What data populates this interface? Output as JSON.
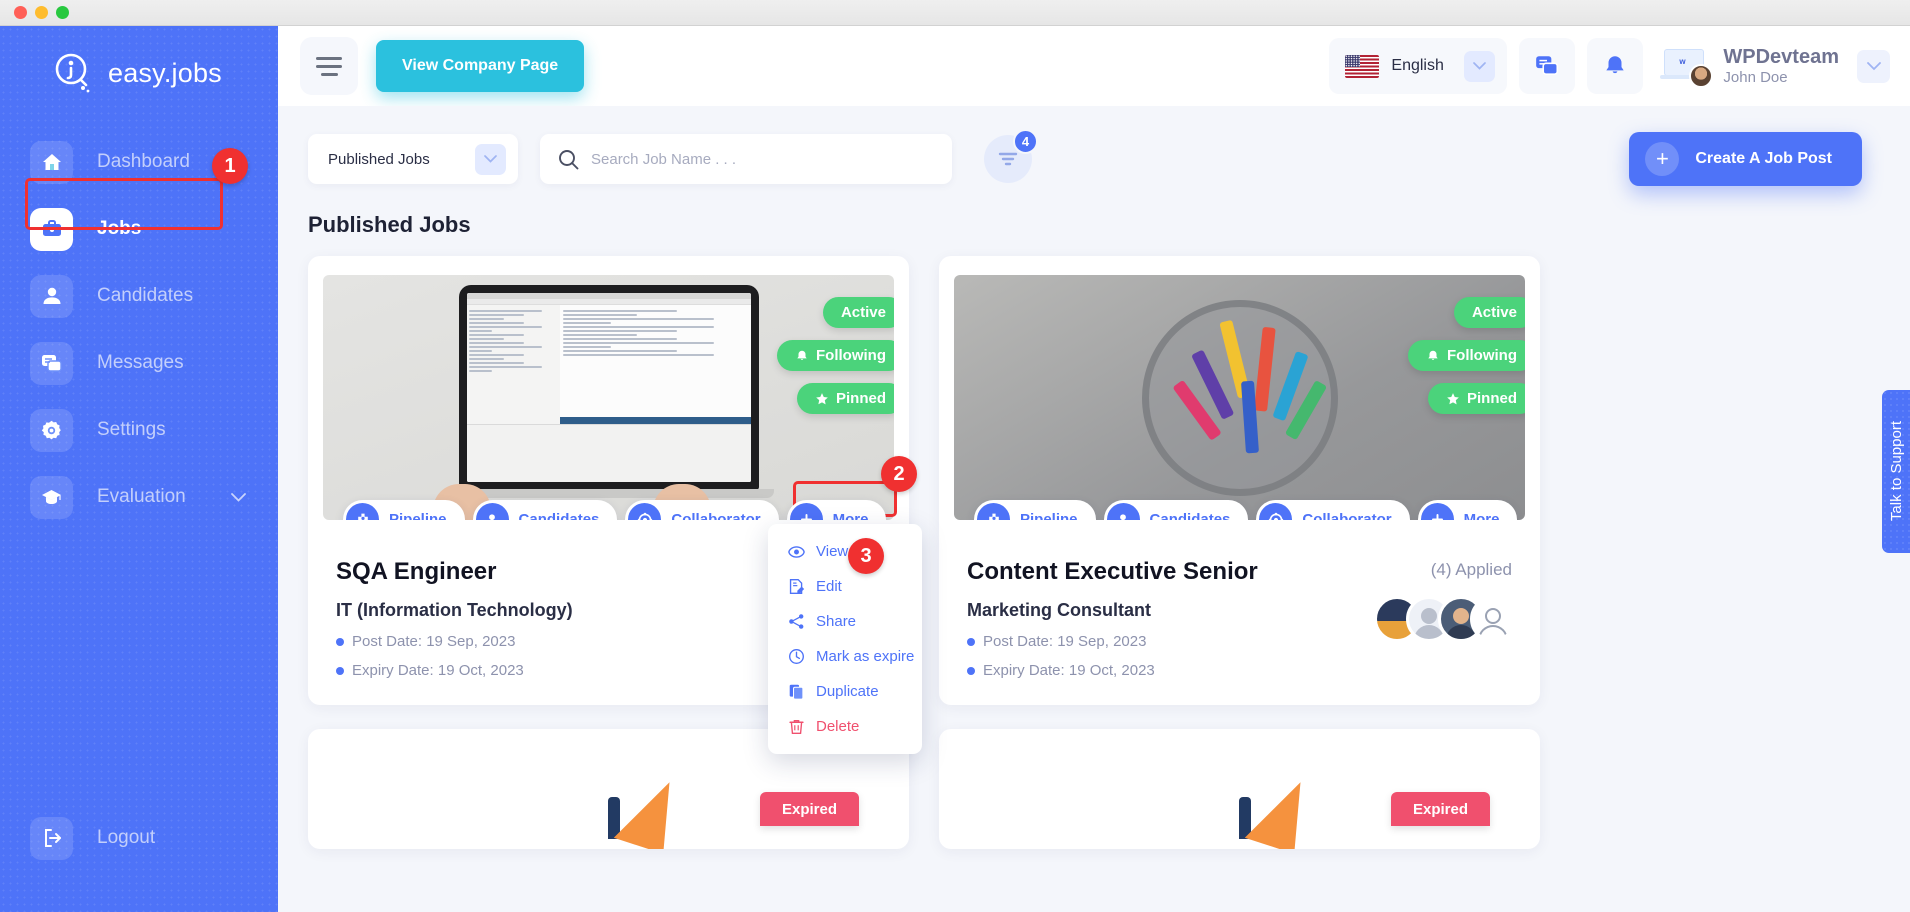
{
  "window": {
    "controls": [
      "close",
      "minimize",
      "maximize"
    ]
  },
  "sidebar": {
    "brand": "easy.jobs",
    "items": [
      {
        "label": "Dashboard",
        "icon": "home-icon",
        "active": false
      },
      {
        "label": "Jobs",
        "icon": "briefcase-icon",
        "active": true
      },
      {
        "label": "Candidates",
        "icon": "user-icon",
        "active": false
      },
      {
        "label": "Messages",
        "icon": "chat-icon",
        "active": false
      },
      {
        "label": "Settings",
        "icon": "gear-icon",
        "active": false
      },
      {
        "label": "Evaluation",
        "icon": "graduation-cap-icon",
        "active": false,
        "expandable": true
      }
    ],
    "logout": {
      "label": "Logout",
      "icon": "logout-icon"
    }
  },
  "header": {
    "menu_toggle": "hamburger-icon",
    "view_company_label": "View Company Page",
    "language": {
      "name": "English",
      "flag": "us-flag-icon"
    },
    "messages_icon": "chat-icon",
    "notifications_icon": "bell-icon",
    "user": {
      "company": "WPDevteam",
      "name": "John Doe"
    }
  },
  "toolbar": {
    "status_filter": "Published Jobs",
    "search_placeholder": "Search Job Name . . .",
    "search_value": "",
    "filter_count": "4",
    "create_label": "Create A Job Post"
  },
  "section": {
    "title": "Published Jobs"
  },
  "jobs": [
    {
      "title": "SQA Engineer",
      "category": "IT (Information Technology)",
      "post_date": "Post Date: 19 Sep, 2023",
      "expiry_date": "Expiry Date: 19 Oct, 2023",
      "applied": "",
      "badges": [
        "Active",
        "Following",
        "Pinned"
      ],
      "actions": [
        "Pipeline",
        "Candidates",
        "Collaborator",
        "More"
      ]
    },
    {
      "title": "Content Executive Senior",
      "category": "Marketing Consultant",
      "post_date": "Post Date: 19 Sep, 2023",
      "expiry_date": "Expiry Date: 19 Oct, 2023",
      "applied": "(4) Applied",
      "badges": [
        "Active",
        "Following",
        "Pinned"
      ],
      "actions": [
        "Pipeline",
        "Candidates",
        "Collaborator",
        "More"
      ]
    }
  ],
  "dropdown": {
    "items": [
      {
        "label": "View",
        "icon": "eye-icon",
        "danger": false
      },
      {
        "label": "Edit",
        "icon": "edit-icon",
        "danger": false
      },
      {
        "label": "Share",
        "icon": "share-icon",
        "danger": false
      },
      {
        "label": "Mark as expire",
        "icon": "clock-icon",
        "danger": false
      },
      {
        "label": "Duplicate",
        "icon": "copy-icon",
        "danger": false
      },
      {
        "label": "Delete",
        "icon": "trash-icon",
        "danger": true
      }
    ]
  },
  "bottom_cards": [
    {
      "status": "Expired"
    },
    {
      "status": "Expired"
    }
  ],
  "support": {
    "label": "Talk to Support"
  },
  "steps": [
    {
      "number": "1",
      "target": "sidebar-item-jobs"
    },
    {
      "number": "2",
      "target": "more-action-button"
    },
    {
      "number": "3",
      "target": "dropdown-item-edit"
    }
  ],
  "colors": {
    "brand_blue": "#4e73f8",
    "cyan": "#2bc1de",
    "green": "#4bd37b",
    "red": "#f03030",
    "pink": "#f0506e",
    "page_bg": "#f4f6fb"
  }
}
